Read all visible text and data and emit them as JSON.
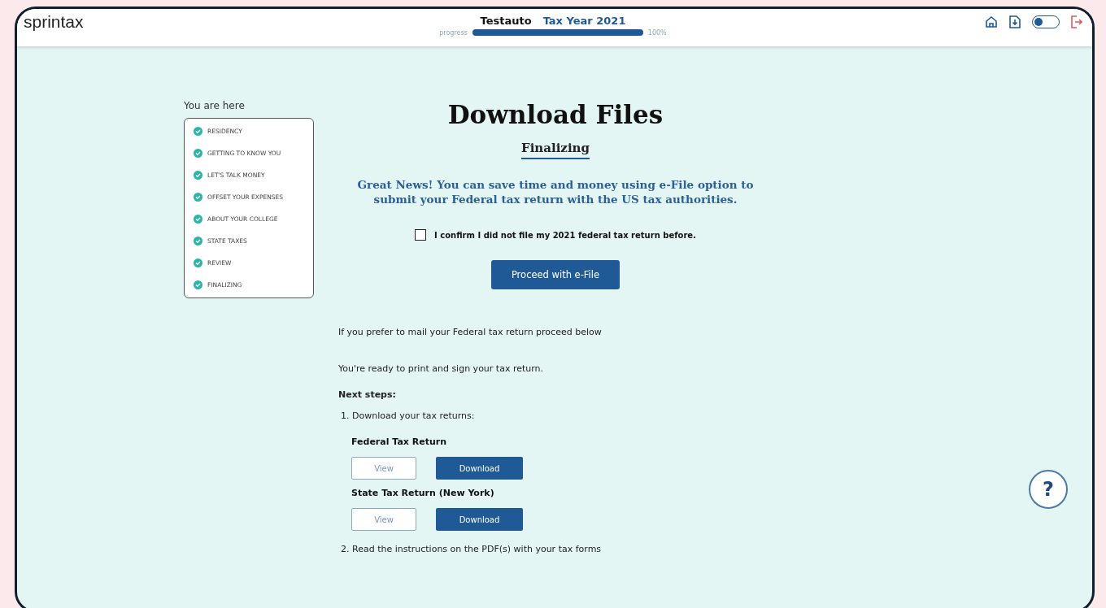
{
  "header": {
    "logo": "sprintax",
    "user": "Testauto",
    "tax_year": "Tax Year 2021",
    "progress_label": "progress",
    "progress": {
      "level": 1.0
    },
    "progress_reading": "100%",
    "theme_toggle": {
      "on": false
    }
  },
  "sidebar": {
    "title": "You are here",
    "steps": [
      {
        "label": "RESIDENCY",
        "done": true
      },
      {
        "label": "GETTING TO KNOW YOU",
        "done": true
      },
      {
        "label": "LET'S TALK MONEY",
        "done": true
      },
      {
        "label": "OFFSET YOUR EXPENSES",
        "done": true
      },
      {
        "label": "ABOUT YOUR COLLEGE",
        "done": true
      },
      {
        "label": "STATE TAXES",
        "done": true
      },
      {
        "label": "REVIEW",
        "done": true
      },
      {
        "label": "FINALIZING",
        "done": true
      }
    ]
  },
  "main": {
    "title": "Download Files",
    "subtitle": "Finalizing",
    "notice": "Great News! You can save time and money using e-File option to submit your Federal tax return with the US tax authorities.",
    "confirm": {
      "label": "I confirm I did not file my 2021 federal tax return before.",
      "checked": false
    },
    "efile_button": "Proceed with e-File",
    "mail_text": "If you prefer to mail your Federal tax return proceed below",
    "ready_text": "You're ready to print and sign your tax return.",
    "next_steps_title": "Next steps:",
    "step_1": "1. Download your tax returns:",
    "returns": [
      {
        "title": "Federal Tax Return",
        "view": "View",
        "download": "Download"
      },
      {
        "title": "State Tax Return (New York)",
        "view": "View",
        "download": "Download"
      }
    ],
    "step_2": "2. Read the instructions on the PDF(s) with your tax forms"
  },
  "help_button": "?"
}
